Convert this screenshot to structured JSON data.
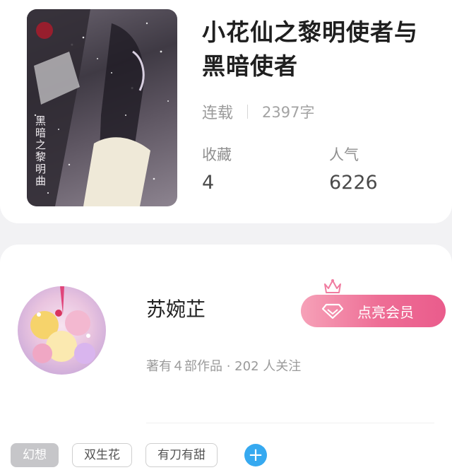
{
  "book": {
    "title": "小花仙之黎明使者与黑暗使者",
    "status": "连载",
    "word_count": "2397字",
    "favorites_label": "收藏",
    "favorites_value": "4",
    "popularity_label": "人气",
    "popularity_value": "6226",
    "cover_text": "黑暗之黎明曲"
  },
  "author": {
    "name": "苏婉芷",
    "meta": "著有４部作品 · 202 人关注",
    "vip_label": "点亮会员"
  },
  "tags": [
    "幻想",
    "双生花",
    "有刀有甜"
  ],
  "add_tag_label": "+",
  "colors": {
    "vip_gradient_start": "#f6a1b8",
    "vip_gradient_end": "#ea5c8c",
    "add_button": "#36a9f0",
    "active_tag": "#c6c6c9"
  }
}
